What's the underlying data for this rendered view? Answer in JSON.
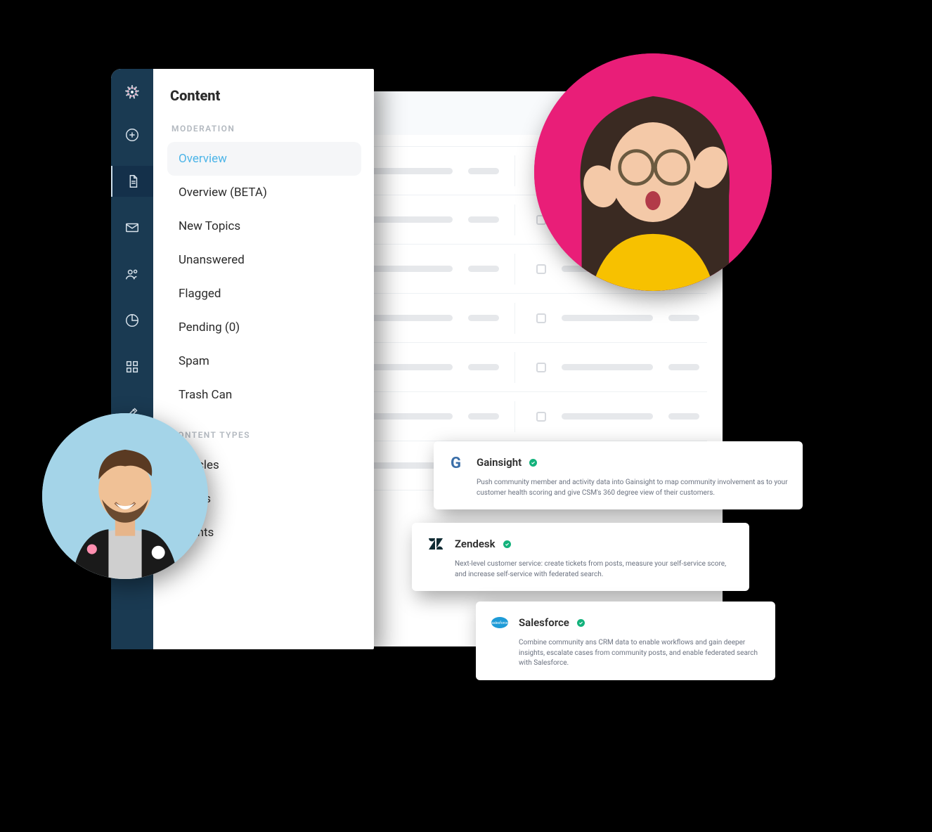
{
  "panel": {
    "title": "Content",
    "sections": [
      {
        "label": "MODERATION",
        "items": [
          {
            "label": "Overview",
            "active": true
          },
          {
            "label": "Overview (BETA)"
          },
          {
            "label": "New Topics"
          },
          {
            "label": "Unanswered"
          },
          {
            "label": "Flagged"
          },
          {
            "label": "Pending (0)"
          },
          {
            "label": "Spam"
          },
          {
            "label": "Trash Can"
          }
        ]
      },
      {
        "label": "CONTENT TYPES",
        "items": [
          {
            "label": "Articles"
          },
          {
            "label": "Drafts"
          },
          {
            "label": "Events"
          }
        ]
      }
    ]
  },
  "rail": {
    "icons": [
      "logo",
      "add",
      "document",
      "mail",
      "users",
      "analytics",
      "apps",
      "pen",
      "tag",
      "chat"
    ]
  },
  "integrations": [
    {
      "name": "Gainsight",
      "verified": true,
      "icon": "gainsight",
      "desc": "Push community member and activity data into Gainsight to map community involvement as to your customer health scoring and give CSM's 360 degree view of their customers."
    },
    {
      "name": "Zendesk",
      "verified": true,
      "icon": "zendesk",
      "desc": "Next-level customer service: create tickets from posts, measure your self-service score, and increase self-service with federated search."
    },
    {
      "name": "Salesforce",
      "verified": true,
      "icon": "salesforce",
      "desc": "Combine community ans CRM data to enable workflows and gain deeper insights, escalate cases from community posts, and enable federated search with Salesforce."
    }
  ],
  "avatars": {
    "left": {
      "bg": "#a4d4e8"
    },
    "right": {
      "bg": "#e91e78"
    }
  },
  "colors": {
    "accent": "#4db5e8",
    "navy": "#1a3a52"
  }
}
